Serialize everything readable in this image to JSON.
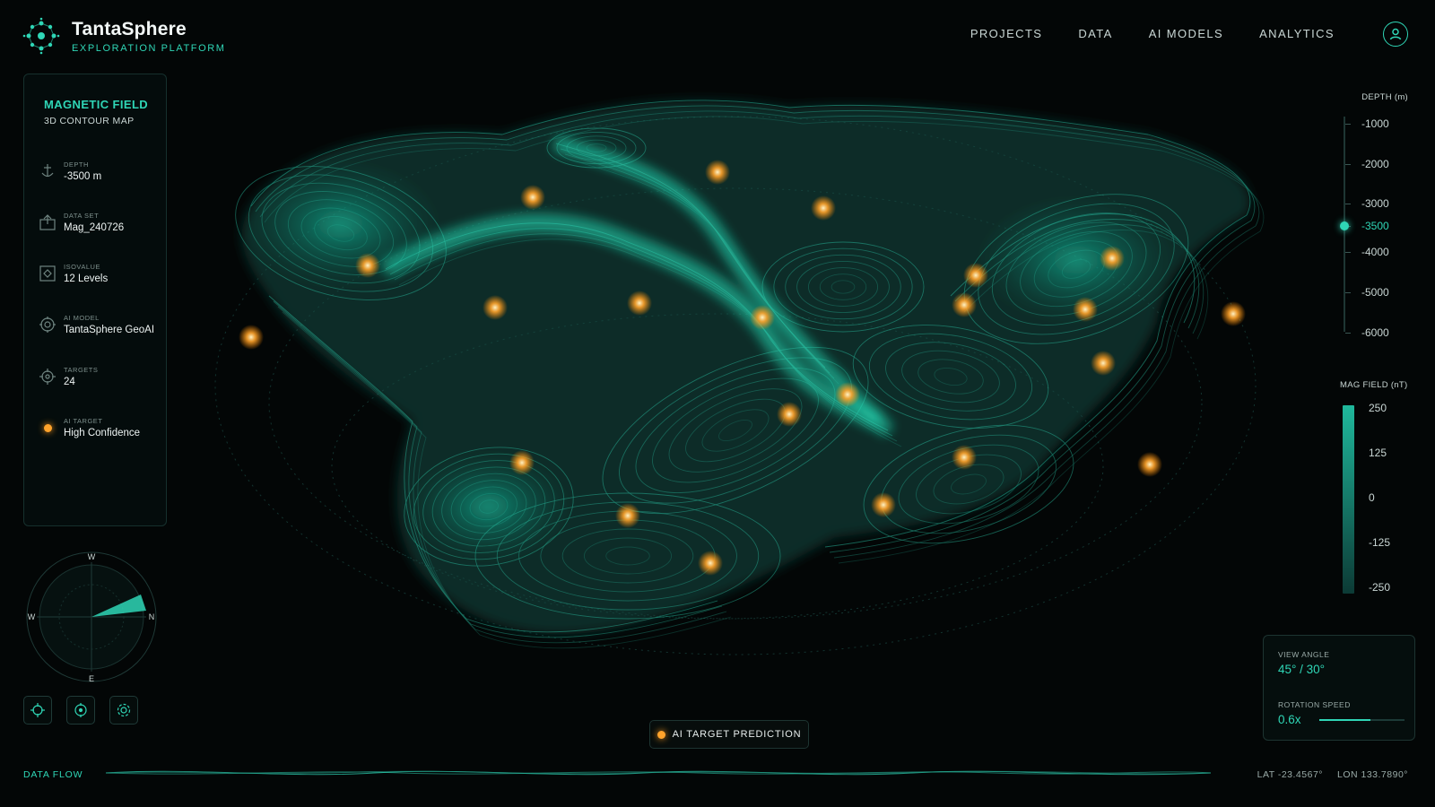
{
  "brand": {
    "name": "TantaSphere",
    "subtitle": "EXPLORATION PLATFORM"
  },
  "nav": {
    "items": [
      "PROJECTS",
      "DATA",
      "AI MODELS",
      "ANALYTICS"
    ]
  },
  "panel": {
    "title": "MAGNETIC FIELD",
    "subtitle": "3D CONTOUR MAP",
    "params": [
      {
        "label": "DEPTH",
        "value": "-3500 m",
        "icon": "depth-anchor-icon"
      },
      {
        "label": "DATA SET",
        "value": "Mag_240726",
        "icon": "dataset-icon"
      },
      {
        "label": "ISOVALUE",
        "value": "12 Levels",
        "icon": "isovalue-icon"
      },
      {
        "label": "AI MODEL",
        "value": "TantaSphere GeoAI",
        "icon": "ai-model-icon"
      },
      {
        "label": "TARGETS",
        "value": "24",
        "icon": "targets-icon"
      },
      {
        "label": "AI TARGET",
        "value": "High Confidence",
        "icon": "target-dot-icon"
      }
    ]
  },
  "compass": {
    "labels": {
      "top": "W",
      "left": "W",
      "right": "N",
      "bottom": "E"
    }
  },
  "tools": [
    "add-target-icon",
    "crosshair-icon",
    "settings-gear-icon"
  ],
  "depth_scale": {
    "title": "DEPTH (m)",
    "ticks": [
      "-1000",
      "-2000",
      "-3000",
      "-3500",
      "-4000",
      "-5000",
      "-6000"
    ],
    "current": "-3500"
  },
  "mag_scale": {
    "title": "MAG FIELD (nT)",
    "ticks": [
      "250",
      "125",
      "0",
      "-125",
      "-250"
    ]
  },
  "view": {
    "angle_label": "VIEW ANGLE",
    "angle_value": "45° / 30°",
    "speed_label": "ROTATION SPEED",
    "speed_value": "0.6x",
    "speed_fraction": 0.6
  },
  "legend": {
    "ai_target": "AI TARGET PREDICTION"
  },
  "footer": {
    "flow_label": "DATA FLOW",
    "lat": "LAT -23.4567°",
    "lon": "LON 133.7890°"
  },
  "colors": {
    "accent": "#2fd6b6",
    "target": "#ffa32b",
    "background": "#030606"
  }
}
